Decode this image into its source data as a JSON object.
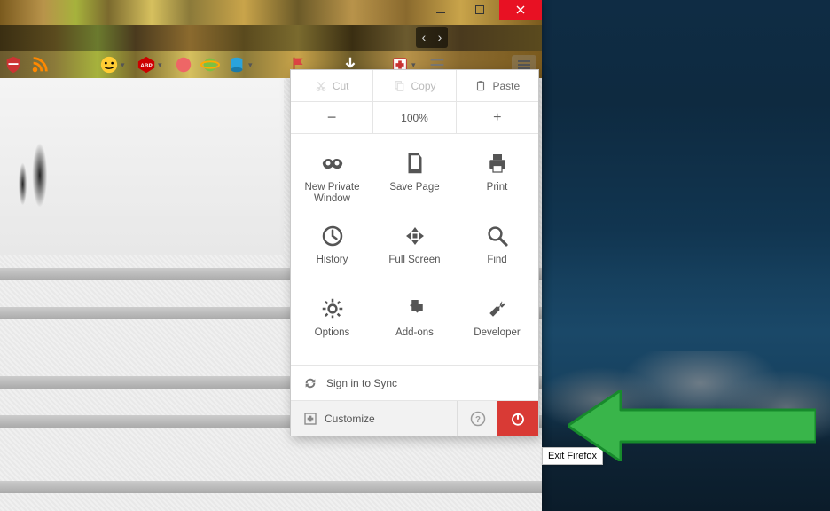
{
  "window": {
    "close": "×",
    "min": "—",
    "max": "□"
  },
  "menu": {
    "edit": {
      "cut": "Cut",
      "copy": "Copy",
      "paste": "Paste"
    },
    "zoom": {
      "out": "−",
      "level": "100%",
      "in": "+"
    },
    "grid": [
      {
        "key": "new_private",
        "label": "New Private\nWindow"
      },
      {
        "key": "save_page",
        "label": "Save Page"
      },
      {
        "key": "print",
        "label": "Print"
      },
      {
        "key": "history",
        "label": "History"
      },
      {
        "key": "full_screen",
        "label": "Full Screen"
      },
      {
        "key": "find",
        "label": "Find"
      },
      {
        "key": "options",
        "label": "Options"
      },
      {
        "key": "addons",
        "label": "Add-ons"
      },
      {
        "key": "developer",
        "label": "Developer"
      }
    ],
    "sync": "Sign in to Sync",
    "customize": "Customize"
  },
  "tooltip": "Exit Firefox",
  "toolbar_icons": [
    "shield-icon",
    "rss-icon",
    "abp-icon",
    "smiley-icon",
    "abp-badge-icon",
    "puzzle-icon",
    "planet-icon",
    "db-icon",
    "flag-icon",
    "download-icon",
    "medic-icon",
    "list-icon"
  ],
  "colors": {
    "accent_red": "#d93a35",
    "close_red": "#e81123",
    "arrow_green": "#39b54a"
  }
}
